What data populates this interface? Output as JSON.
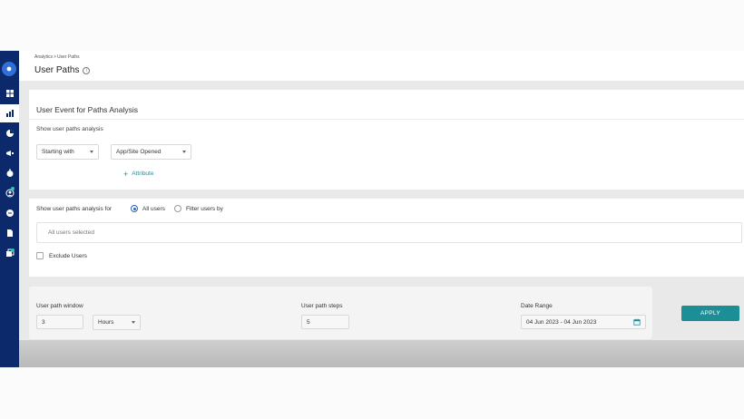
{
  "header": {
    "breadcrumb": [
      "Analytics",
      "User Paths"
    ],
    "breadcrumb_sep": ">",
    "title": "User Paths",
    "info_glyph": "i"
  },
  "event_card": {
    "title": "User Event for Paths Analysis",
    "subtitle": "Show user paths analysis",
    "start_select": "Starting with",
    "event_select": "App/Site Opened",
    "add_attribute": "Attribute"
  },
  "users_card": {
    "label": "Show user paths analysis for",
    "radio_all": "All users",
    "radio_filter": "Filter users by",
    "selected_users": "All users selected",
    "exclude_label": "Exclude Users"
  },
  "settings_card": {
    "window_label": "User path window",
    "window_value": "3",
    "unit_value": "Hours",
    "steps_label": "User path steps",
    "steps_value": "5",
    "date_label": "Date Range",
    "date_value": "04 Jun 2023 - 04 Jun 2023"
  },
  "apply_label": "APPLY",
  "colors": {
    "sidebar": "#0c2a6b",
    "accent": "#1c8f96",
    "radio": "#2563c9"
  },
  "sidebar_icons": [
    "home-icon",
    "dashboard-icon",
    "analytics-icon",
    "pie-chart-icon",
    "megaphone-icon",
    "timer-icon",
    "user-icon",
    "chat-icon",
    "document-icon",
    "cards-icon"
  ]
}
